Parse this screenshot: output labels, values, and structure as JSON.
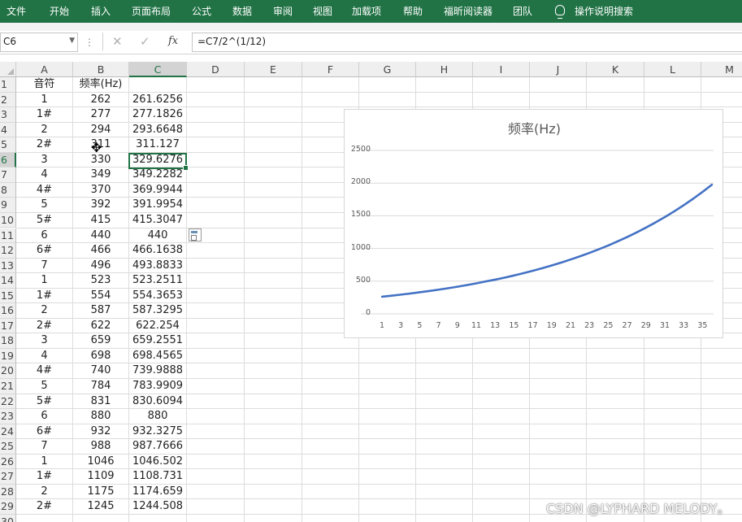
{
  "ribbon": {
    "tabs": [
      "文件",
      "开始",
      "插入",
      "页面布局",
      "公式",
      "数据",
      "审阅",
      "视图",
      "加载项",
      "帮助",
      "福昕阅读器",
      "团队"
    ],
    "search": "操作说明搜索"
  },
  "formula_bar": {
    "name_box": "C6",
    "formula": "=C7/2^(1/12)",
    "cancel_icon": "✕",
    "enter_icon": "✓",
    "fx_label": "fx"
  },
  "sheet": {
    "columns": [
      "A",
      "B",
      "C",
      "D",
      "E",
      "F",
      "G",
      "H",
      "I",
      "J",
      "K",
      "L",
      "M"
    ],
    "active_cell": "C6",
    "rows": [
      [
        "音符",
        "频率(Hz)",
        ""
      ],
      [
        "1",
        "262",
        "261.6256"
      ],
      [
        "1#",
        "277",
        "277.1826"
      ],
      [
        "2",
        "294",
        "293.6648"
      ],
      [
        "2#",
        "311",
        "311.127"
      ],
      [
        "3",
        "330",
        "329.6276"
      ],
      [
        "4",
        "349",
        "349.2282"
      ],
      [
        "4#",
        "370",
        "369.9944"
      ],
      [
        "5",
        "392",
        "391.9954"
      ],
      [
        "5#",
        "415",
        "415.3047"
      ],
      [
        "6",
        "440",
        "440"
      ],
      [
        "6#",
        "466",
        "466.1638"
      ],
      [
        "7",
        "496",
        "493.8833"
      ],
      [
        "1",
        "523",
        "523.2511"
      ],
      [
        "1#",
        "554",
        "554.3653"
      ],
      [
        "2",
        "587",
        "587.3295"
      ],
      [
        "2#",
        "622",
        "622.254"
      ],
      [
        "3",
        "659",
        "659.2551"
      ],
      [
        "4",
        "698",
        "698.4565"
      ],
      [
        "4#",
        "740",
        "739.9888"
      ],
      [
        "5",
        "784",
        "783.9909"
      ],
      [
        "5#",
        "831",
        "830.6094"
      ],
      [
        "6",
        "880",
        "880"
      ],
      [
        "6#",
        "932",
        "932.3275"
      ],
      [
        "7",
        "988",
        "987.7666"
      ],
      [
        "1",
        "1046",
        "1046.502"
      ],
      [
        "1#",
        "1109",
        "1108.731"
      ],
      [
        "2",
        "1175",
        "1174.659"
      ],
      [
        "2#",
        "1245",
        "1244.508"
      ]
    ]
  },
  "chart_data": {
    "type": "line",
    "title": "频率(Hz)",
    "xlabel": "",
    "ylabel": "",
    "ylim": [
      0,
      2500
    ],
    "yticks": [
      0,
      500,
      1000,
      1500,
      2000,
      2500
    ],
    "xticks": [
      "1",
      "3",
      "5",
      "7",
      "9",
      "11",
      "13",
      "15",
      "17",
      "19",
      "21",
      "23",
      "25",
      "27",
      "29",
      "31",
      "33",
      "35"
    ],
    "grid": "horizontal",
    "legend": "none",
    "color": "#4472c4",
    "x": [
      1,
      2,
      3,
      4,
      5,
      6,
      7,
      8,
      9,
      10,
      11,
      12,
      13,
      14,
      15,
      16,
      17,
      18,
      19,
      20,
      21,
      22,
      23,
      24,
      25,
      26,
      27,
      28,
      29,
      30,
      31,
      32,
      33,
      34,
      35,
      36
    ],
    "series": [
      {
        "values": [
          262,
          277,
          294,
          311,
          330,
          349,
          370,
          392,
          415,
          440,
          466,
          496,
          523,
          554,
          587,
          622,
          659,
          698,
          740,
          784,
          831,
          880,
          932,
          988,
          1046,
          1109,
          1175,
          1245,
          1319,
          1397,
          1480,
          1568,
          1661,
          1760,
          1865,
          1976
        ]
      }
    ]
  },
  "watermark": "CSDN @LYPHARD MELODY。"
}
